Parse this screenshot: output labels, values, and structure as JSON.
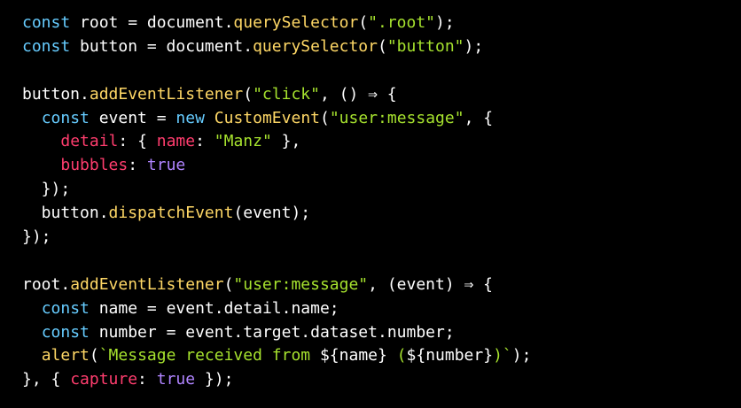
{
  "theme": {
    "background": "#000000",
    "colors": {
      "plain": "#ffffff",
      "keyword": "#66ccff",
      "func": "#ffd866",
      "string": "#a6e22e",
      "prop": "#ff3d6e",
      "bool": "#b084ff",
      "punct": "#ffffff"
    }
  },
  "code_lines": [
    [
      [
        "keyword",
        "const"
      ],
      [
        "plain",
        " root = document."
      ],
      [
        "func",
        "querySelector"
      ],
      [
        "punct",
        "("
      ],
      [
        "string",
        "\".root\""
      ],
      [
        "punct",
        ");"
      ]
    ],
    [
      [
        "keyword",
        "const"
      ],
      [
        "plain",
        " button = document."
      ],
      [
        "func",
        "querySelector"
      ],
      [
        "punct",
        "("
      ],
      [
        "string",
        "\"button\""
      ],
      [
        "punct",
        ");"
      ]
    ],
    [],
    [
      [
        "plain",
        "button."
      ],
      [
        "func",
        "addEventListener"
      ],
      [
        "punct",
        "("
      ],
      [
        "string",
        "\"click\""
      ],
      [
        "punct",
        ", () ⇒ {"
      ]
    ],
    [
      [
        "plain",
        "  "
      ],
      [
        "keyword",
        "const"
      ],
      [
        "plain",
        " event = "
      ],
      [
        "keyword",
        "new"
      ],
      [
        "plain",
        " "
      ],
      [
        "func",
        "CustomEvent"
      ],
      [
        "punct",
        "("
      ],
      [
        "string",
        "\"user:message\""
      ],
      [
        "punct",
        ", {"
      ]
    ],
    [
      [
        "plain",
        "    "
      ],
      [
        "prop",
        "detail"
      ],
      [
        "punct",
        ": { "
      ],
      [
        "prop",
        "name"
      ],
      [
        "punct",
        ": "
      ],
      [
        "string",
        "\"Manz\""
      ],
      [
        "punct",
        " },"
      ]
    ],
    [
      [
        "plain",
        "    "
      ],
      [
        "prop",
        "bubbles"
      ],
      [
        "punct",
        ": "
      ],
      [
        "bool",
        "true"
      ]
    ],
    [
      [
        "plain",
        "  });"
      ]
    ],
    [
      [
        "plain",
        "  button."
      ],
      [
        "func",
        "dispatchEvent"
      ],
      [
        "punct",
        "(event);"
      ]
    ],
    [
      [
        "plain",
        "});"
      ]
    ],
    [],
    [
      [
        "plain",
        "root."
      ],
      [
        "func",
        "addEventListener"
      ],
      [
        "punct",
        "("
      ],
      [
        "string",
        "\"user:message\""
      ],
      [
        "punct",
        ", (event) ⇒ {"
      ]
    ],
    [
      [
        "plain",
        "  "
      ],
      [
        "keyword",
        "const"
      ],
      [
        "plain",
        " name = event.detail.name;"
      ]
    ],
    [
      [
        "plain",
        "  "
      ],
      [
        "keyword",
        "const"
      ],
      [
        "plain",
        " number = event.target.dataset.number;"
      ]
    ],
    [
      [
        "plain",
        "  "
      ],
      [
        "func",
        "alert"
      ],
      [
        "punct",
        "("
      ],
      [
        "string",
        "`Message received from "
      ],
      [
        "plain",
        "${name}"
      ],
      [
        "string",
        " ("
      ],
      [
        "plain",
        "${number}"
      ],
      [
        "string",
        ")`"
      ],
      [
        "punct",
        ");"
      ]
    ],
    [
      [
        "punct",
        "}, { "
      ],
      [
        "prop",
        "capture"
      ],
      [
        "punct",
        ": "
      ],
      [
        "bool",
        "true"
      ],
      [
        "punct",
        " });"
      ]
    ]
  ]
}
